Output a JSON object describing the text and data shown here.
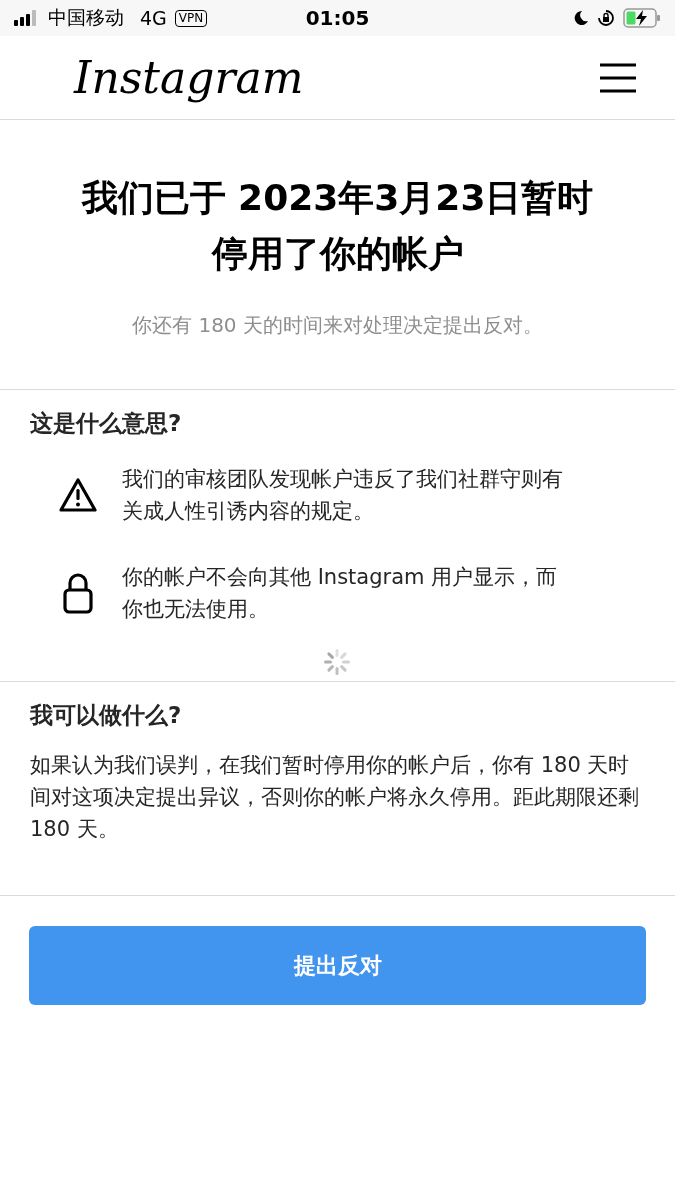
{
  "status_bar": {
    "carrier": "中国移动",
    "network": "4G",
    "vpn": "VPN",
    "time": "01:05"
  },
  "header": {
    "logo": "Instagram"
  },
  "notice": {
    "title": "我们已于 2023年3月23日暂时停用了你的帐户",
    "subtitle": "你还有 180 天的时间来对处理决定提出反对。"
  },
  "meaning": {
    "heading": "这是什么意思?",
    "items": [
      {
        "kind": "warning",
        "text": "我们的审核团队发现帐户违反了我们社群守则有关成人性引诱内容的规定。"
      },
      {
        "kind": "lock",
        "text": "你的帐户不会向其他 Instagram 用户显示，而你也无法使用。"
      }
    ]
  },
  "actions": {
    "heading": "我可以做什么?",
    "text": "如果认为我们误判，在我们暂时停用你的帐户后，你有 180 天时间对这项决定提出异议，否则你的帐户将永久停用。距此期限还剩 180 天。"
  },
  "button": {
    "label": "提出反对"
  }
}
